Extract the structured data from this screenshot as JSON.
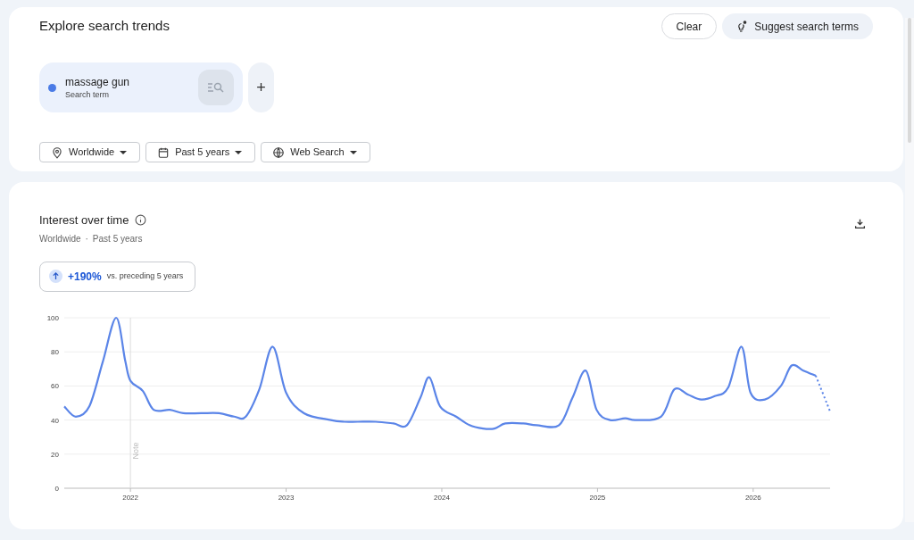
{
  "header": {
    "title": "Explore search trends",
    "clear_button": "Clear",
    "suggest_button": "Suggest search terms"
  },
  "terms": [
    {
      "name": "massage gun",
      "subtitle": "Search term",
      "color": "#4a7be6"
    }
  ],
  "add_button": "+",
  "filters": [
    {
      "kind": "location",
      "label": "Worldwide"
    },
    {
      "kind": "time",
      "label": "Past 5 years"
    },
    {
      "kind": "property",
      "label": "Web Search"
    }
  ],
  "interest": {
    "title": "Interest over time",
    "subtitle_parts": [
      "Worldwide",
      "·",
      "Past 5 years"
    ],
    "change": "+190%",
    "change_note": "vs. preceding 5 years",
    "chart_data": {
      "type": "line",
      "xlim": [
        2021.575,
        2026.494
      ],
      "ylim": [
        0,
        100
      ],
      "yticks": [
        0,
        20,
        40,
        60,
        80,
        100
      ],
      "xticks": [
        2022,
        2023,
        2024,
        2025,
        2026
      ],
      "grid": true,
      "ref_lines": [
        {
          "axis": "x",
          "value": 2022,
          "label": "Note"
        }
      ],
      "series": [
        {
          "color": "#5b85e8",
          "x": [
            2021.575,
            2021.649,
            2021.736,
            2021.822,
            2021.908,
            2021.966,
            2022.0,
            2022.08,
            2022.149,
            2022.253,
            2022.339,
            2022.454,
            2022.569,
            2022.667,
            2022.741,
            2022.828,
            2022.914,
            2023.0,
            2023.115,
            2023.287,
            2023.374,
            2023.46,
            2023.575,
            2023.69,
            2023.776,
            2023.862,
            2023.92,
            2023.989,
            2024.092,
            2024.178,
            2024.264,
            2024.339,
            2024.408,
            2024.523,
            2024.609,
            2024.753,
            2024.839,
            2024.925,
            2024.994,
            2025.08,
            2025.178,
            2025.247,
            2025.408,
            2025.494,
            2025.58,
            2025.667,
            2025.753,
            2025.839,
            2025.925,
            2025.983,
            2026.075,
            2026.178,
            2026.247,
            2026.322,
            2026.402,
            2026.494
          ],
          "values": [
            48,
            42,
            48,
            74,
            100,
            75,
            63,
            57,
            46,
            46,
            44,
            44,
            44,
            42,
            42,
            58,
            83,
            56,
            44,
            40,
            39,
            39,
            39,
            38,
            37,
            53,
            65,
            48,
            42,
            37,
            35,
            35,
            38,
            38,
            37,
            37,
            53,
            69,
            46,
            40,
            41,
            40,
            42,
            58,
            55,
            52,
            54,
            59,
            83,
            56,
            52,
            60,
            72,
            69,
            66,
            45
          ]
        }
      ]
    }
  }
}
